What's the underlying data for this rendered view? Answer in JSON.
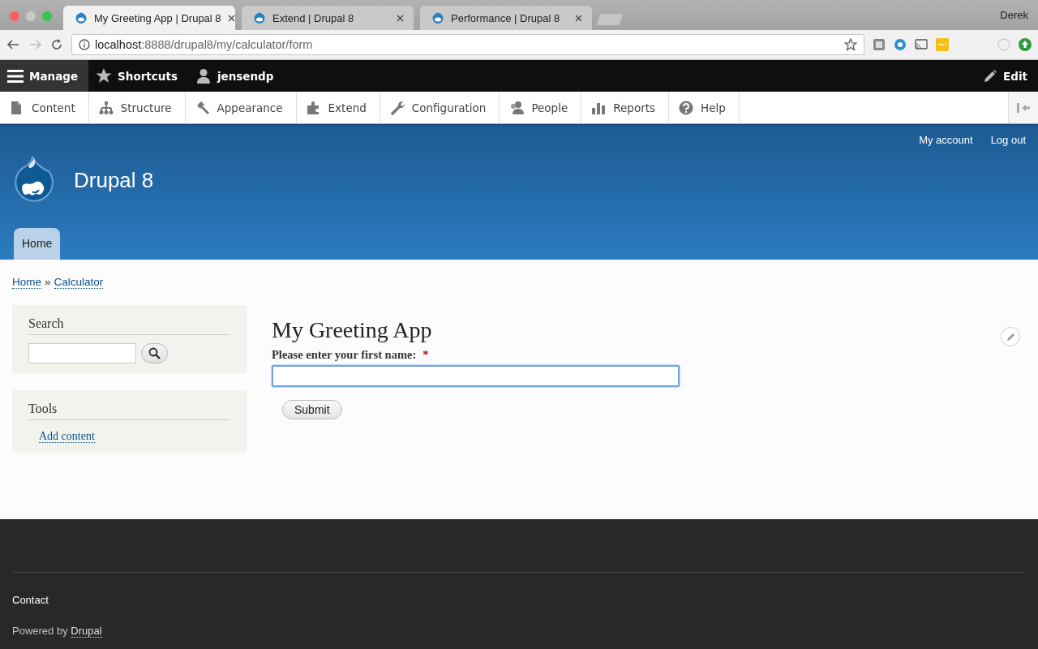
{
  "browser": {
    "tabs": [
      {
        "title": "My Greeting App | Drupal 8",
        "selected": true
      },
      {
        "title": "Extend | Drupal 8",
        "selected": false
      },
      {
        "title": "Performance | Drupal 8",
        "selected": false
      }
    ],
    "user": "Derek",
    "url_host": "localhost",
    "url_path": ":8888/drupal8/my/calculator/form"
  },
  "toolbar": {
    "items": [
      {
        "label": "Manage",
        "kind": "menu",
        "selected": true
      },
      {
        "label": "Shortcuts",
        "kind": "star",
        "selected": false
      },
      {
        "label": "jensendp",
        "kind": "user",
        "selected": false
      }
    ],
    "edit": "Edit",
    "tray": [
      {
        "label": "Content",
        "kind": "content"
      },
      {
        "label": "Structure",
        "kind": "structure"
      },
      {
        "label": "Appearance",
        "kind": "appearance"
      },
      {
        "label": "Extend",
        "kind": "extend"
      },
      {
        "label": "Configuration",
        "kind": "configuration"
      },
      {
        "label": "People",
        "kind": "people"
      },
      {
        "label": "Reports",
        "kind": "reports"
      },
      {
        "label": "Help",
        "kind": "help"
      }
    ]
  },
  "header": {
    "secondary_menu": [
      "My account",
      "Log out"
    ],
    "site_name": "Drupal 8",
    "tabs": [
      {
        "label": "Home",
        "selected": true
      }
    ]
  },
  "breadcrumb": {
    "links": [
      "Home",
      "Calculator"
    ],
    "separator": "»"
  },
  "sidebar": {
    "search": {
      "title": "Search"
    },
    "tools": {
      "title": "Tools",
      "links": [
        "Add content"
      ]
    }
  },
  "content": {
    "title": "My Greeting App",
    "field": {
      "label": "Please enter your first name:",
      "required": true,
      "required_marker": "*",
      "focused": true
    },
    "submit": "Submit"
  },
  "footer": {
    "links": [
      "Contact"
    ],
    "powered_by": "Powered by",
    "powered_link": "Drupal"
  }
}
